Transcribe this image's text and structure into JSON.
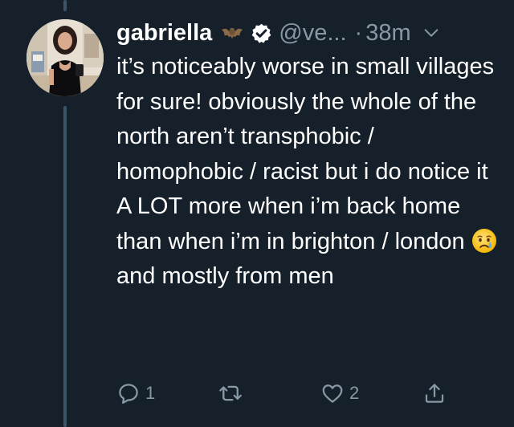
{
  "tweet": {
    "author": {
      "display_name": "gabriella",
      "handle": "@ve...",
      "name_emoji": "bat-icon",
      "verified": true
    },
    "separator": "·",
    "time": "38m",
    "text_before_emoji": "it’s noticeably worse in small villages for sure! obviously the whole of the north aren’t transphobic / homophobic / racist but i do notice it A LOT more when i’m back home than when i’m in brighton / london ",
    "inline_emoji": "crying-face-icon",
    "text_after_emoji": " and mostly from men",
    "actions": {
      "reply_count": "1",
      "retweet_count": "",
      "like_count": "2"
    }
  },
  "colors": {
    "background": "#15202b",
    "text": "#ffffff",
    "secondary_text": "#8899a6",
    "thread_line": "#3d5466"
  },
  "icons": [
    "avatar",
    "bat-icon",
    "verified-badge-icon",
    "chevron-down-icon",
    "crying-face-icon",
    "reply-icon",
    "retweet-icon",
    "like-icon",
    "share-icon"
  ]
}
